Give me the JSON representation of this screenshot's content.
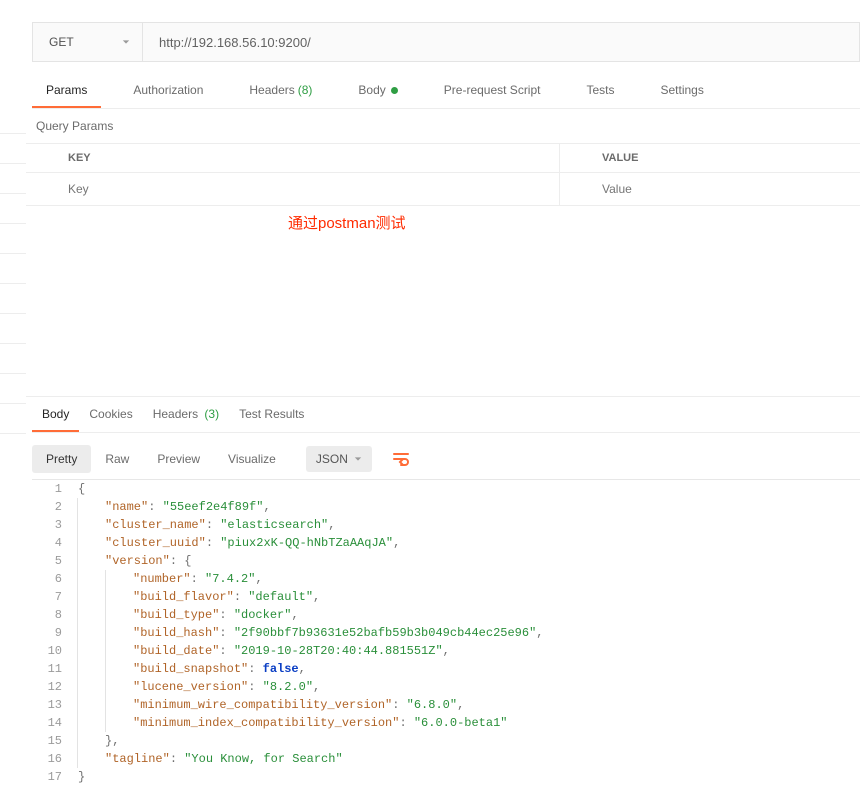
{
  "gutter_ticks": 11,
  "request": {
    "method": "GET",
    "url": "http://192.168.56.10:9200/"
  },
  "reqtabs": [
    {
      "id": "params",
      "label": "Params",
      "active": true
    },
    {
      "id": "auth",
      "label": "Authorization"
    },
    {
      "id": "headers",
      "label": "Headers",
      "count": "(8)"
    },
    {
      "id": "body",
      "label": "Body",
      "dot": true
    },
    {
      "id": "prereq",
      "label": "Pre-request Script"
    },
    {
      "id": "tests",
      "label": "Tests"
    },
    {
      "id": "settings",
      "label": "Settings"
    }
  ],
  "query_params": {
    "title": "Query Params",
    "key_header": "KEY",
    "value_header": "VALUE",
    "key_placeholder": "Key",
    "value_placeholder": "Value"
  },
  "annotation": "通过postman测试",
  "resptabs": [
    {
      "id": "body",
      "label": "Body",
      "active": true
    },
    {
      "id": "cookies",
      "label": "Cookies"
    },
    {
      "id": "headers",
      "label": "Headers",
      "count": "(3)"
    },
    {
      "id": "testresults",
      "label": "Test Results"
    }
  ],
  "view_modes": [
    {
      "id": "pretty",
      "label": "Pretty",
      "active": true
    },
    {
      "id": "raw",
      "label": "Raw"
    },
    {
      "id": "preview",
      "label": "Preview"
    },
    {
      "id": "visualize",
      "label": "Visualize"
    }
  ],
  "format_select": {
    "label": "JSON"
  },
  "code_lines": [
    {
      "n": 1,
      "indent": 0,
      "tokens": [
        {
          "t": "brace",
          "v": "{"
        }
      ]
    },
    {
      "n": 2,
      "indent": 1,
      "tokens": [
        {
          "t": "key",
          "v": "\"name\""
        },
        {
          "t": "punct",
          "v": ": "
        },
        {
          "t": "str",
          "v": "\"55eef2e4f89f\""
        },
        {
          "t": "punct",
          "v": ","
        }
      ]
    },
    {
      "n": 3,
      "indent": 1,
      "tokens": [
        {
          "t": "key",
          "v": "\"cluster_name\""
        },
        {
          "t": "punct",
          "v": ": "
        },
        {
          "t": "str",
          "v": "\"elasticsearch\""
        },
        {
          "t": "punct",
          "v": ","
        }
      ]
    },
    {
      "n": 4,
      "indent": 1,
      "tokens": [
        {
          "t": "key",
          "v": "\"cluster_uuid\""
        },
        {
          "t": "punct",
          "v": ": "
        },
        {
          "t": "str",
          "v": "\"piux2xK-QQ-hNbTZaAAqJA\""
        },
        {
          "t": "punct",
          "v": ","
        }
      ]
    },
    {
      "n": 5,
      "indent": 1,
      "tokens": [
        {
          "t": "key",
          "v": "\"version\""
        },
        {
          "t": "punct",
          "v": ": "
        },
        {
          "t": "brace",
          "v": "{"
        }
      ]
    },
    {
      "n": 6,
      "indent": 2,
      "tokens": [
        {
          "t": "key",
          "v": "\"number\""
        },
        {
          "t": "punct",
          "v": ": "
        },
        {
          "t": "str",
          "v": "\"7.4.2\""
        },
        {
          "t": "punct",
          "v": ","
        }
      ]
    },
    {
      "n": 7,
      "indent": 2,
      "tokens": [
        {
          "t": "key",
          "v": "\"build_flavor\""
        },
        {
          "t": "punct",
          "v": ": "
        },
        {
          "t": "str",
          "v": "\"default\""
        },
        {
          "t": "punct",
          "v": ","
        }
      ]
    },
    {
      "n": 8,
      "indent": 2,
      "tokens": [
        {
          "t": "key",
          "v": "\"build_type\""
        },
        {
          "t": "punct",
          "v": ": "
        },
        {
          "t": "str",
          "v": "\"docker\""
        },
        {
          "t": "punct",
          "v": ","
        }
      ]
    },
    {
      "n": 9,
      "indent": 2,
      "tokens": [
        {
          "t": "key",
          "v": "\"build_hash\""
        },
        {
          "t": "punct",
          "v": ": "
        },
        {
          "t": "str",
          "v": "\"2f90bbf7b93631e52bafb59b3b049cb44ec25e96\""
        },
        {
          "t": "punct",
          "v": ","
        }
      ]
    },
    {
      "n": 10,
      "indent": 2,
      "tokens": [
        {
          "t": "key",
          "v": "\"build_date\""
        },
        {
          "t": "punct",
          "v": ": "
        },
        {
          "t": "str",
          "v": "\"2019-10-28T20:40:44.881551Z\""
        },
        {
          "t": "punct",
          "v": ","
        }
      ]
    },
    {
      "n": 11,
      "indent": 2,
      "tokens": [
        {
          "t": "key",
          "v": "\"build_snapshot\""
        },
        {
          "t": "punct",
          "v": ": "
        },
        {
          "t": "bool",
          "v": "false"
        },
        {
          "t": "punct",
          "v": ","
        }
      ]
    },
    {
      "n": 12,
      "indent": 2,
      "tokens": [
        {
          "t": "key",
          "v": "\"lucene_version\""
        },
        {
          "t": "punct",
          "v": ": "
        },
        {
          "t": "str",
          "v": "\"8.2.0\""
        },
        {
          "t": "punct",
          "v": ","
        }
      ]
    },
    {
      "n": 13,
      "indent": 2,
      "tokens": [
        {
          "t": "key",
          "v": "\"minimum_wire_compatibility_version\""
        },
        {
          "t": "punct",
          "v": ": "
        },
        {
          "t": "str",
          "v": "\"6.8.0\""
        },
        {
          "t": "punct",
          "v": ","
        }
      ]
    },
    {
      "n": 14,
      "indent": 2,
      "tokens": [
        {
          "t": "key",
          "v": "\"minimum_index_compatibility_version\""
        },
        {
          "t": "punct",
          "v": ": "
        },
        {
          "t": "str",
          "v": "\"6.0.0-beta1\""
        }
      ]
    },
    {
      "n": 15,
      "indent": 1,
      "tokens": [
        {
          "t": "brace",
          "v": "}"
        },
        {
          "t": "punct",
          "v": ","
        }
      ]
    },
    {
      "n": 16,
      "indent": 1,
      "tokens": [
        {
          "t": "key",
          "v": "\"tagline\""
        },
        {
          "t": "punct",
          "v": ": "
        },
        {
          "t": "str",
          "v": "\"You Know, for Search\""
        }
      ]
    },
    {
      "n": 17,
      "indent": 0,
      "tokens": [
        {
          "t": "brace",
          "v": "}"
        }
      ]
    }
  ]
}
